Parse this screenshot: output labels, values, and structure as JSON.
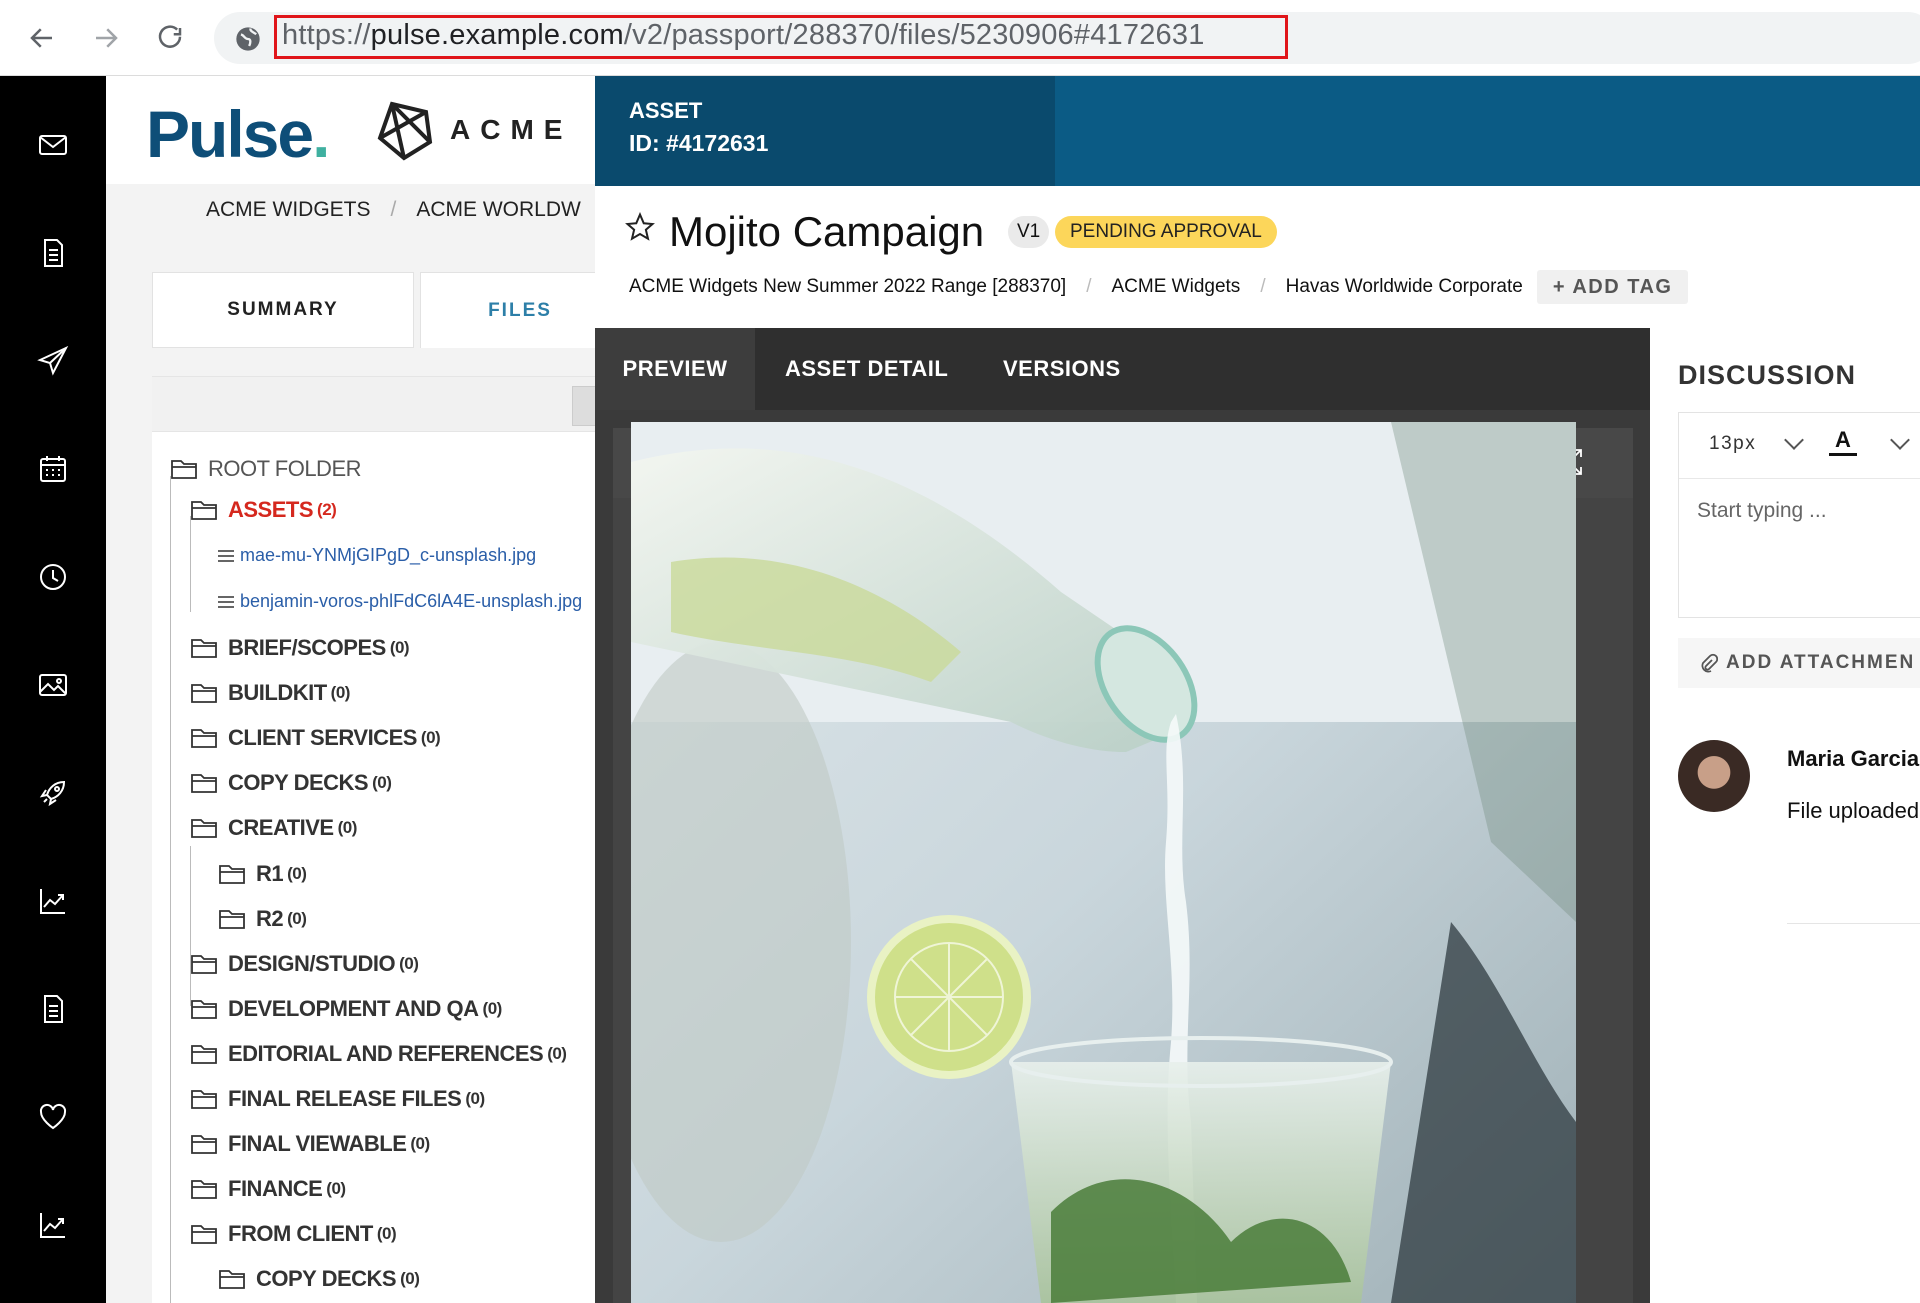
{
  "browser": {
    "url_scheme": "https://",
    "url_host": "pulse.example.com",
    "url_path": "/v2/passport/288370/files/5230906#4172631"
  },
  "rail": {
    "icons": [
      "mail-icon",
      "document-icon",
      "send-icon",
      "calendar-icon",
      "clock-icon",
      "image-icon",
      "rocket-icon",
      "chart-icon",
      "report-icon",
      "heart-icon",
      "analytics-icon"
    ]
  },
  "logos": {
    "pulse": "Pulse",
    "acme": "ACME"
  },
  "breadcrumb": {
    "items": [
      "ACME WIDGETS",
      "ACME WORLDW"
    ]
  },
  "left_tabs": [
    "SUMMARY",
    "FILES"
  ],
  "tree": {
    "root": "ROOT FOLDER",
    "assets": {
      "label": "ASSETS",
      "count": "(2)"
    },
    "files": [
      "mae-mu-YNMjGIPgD_c-unsplash.jpg",
      "benjamin-voros-phlFdC6lA4E-unsplash.jpg"
    ],
    "folders": [
      {
        "label": "BRIEF/SCOPES",
        "count": "(0)"
      },
      {
        "label": "BUILDKIT",
        "count": "(0)"
      },
      {
        "label": "CLIENT SERVICES",
        "count": "(0)"
      },
      {
        "label": "COPY DECKS",
        "count": "(0)"
      },
      {
        "label": "CREATIVE",
        "count": "(0)"
      },
      {
        "label": "R1",
        "count": "(0)"
      },
      {
        "label": "R2",
        "count": "(0)"
      },
      {
        "label": "DESIGN/STUDIO",
        "count": "(0)"
      },
      {
        "label": "DEVELOPMENT AND QA",
        "count": "(0)"
      },
      {
        "label": "EDITORIAL AND REFERENCES",
        "count": "(0)"
      },
      {
        "label": "FINAL RELEASE FILES",
        "count": "(0)"
      },
      {
        "label": "FINAL VIEWABLE",
        "count": "(0)"
      },
      {
        "label": "FINANCE",
        "count": "(0)"
      },
      {
        "label": "FROM CLIENT",
        "count": "(0)"
      },
      {
        "label": "COPY DECKS",
        "count": "(0)"
      }
    ]
  },
  "asset": {
    "label": "ASSET",
    "id": "ID: #4172631",
    "title": "Mojito Campaign",
    "version": "V1",
    "status": "PENDING APPROVAL",
    "meta": [
      "ACME Widgets New Summer 2022 Range [288370]",
      "ACME Widgets",
      "Havas Worldwide Corporate"
    ],
    "add_tag": "+ ADD TAG",
    "status_color": "#fcd65a",
    "header_color": "#0b5b85"
  },
  "preview_tabs": [
    "PREVIEW",
    "ASSET DETAIL",
    "VERSIONS"
  ],
  "preview_tools": [
    "download-icon",
    "print-icon",
    "fullscreen-icon"
  ],
  "discussion": {
    "title": "DISCUSSION",
    "font_size": "13px",
    "font_color_label": "A",
    "placeholder": "Start typing ...",
    "attach_label": "ADD ATTACHMEN",
    "comment": {
      "name": "Maria Garcia",
      "text": "File uploaded"
    }
  }
}
